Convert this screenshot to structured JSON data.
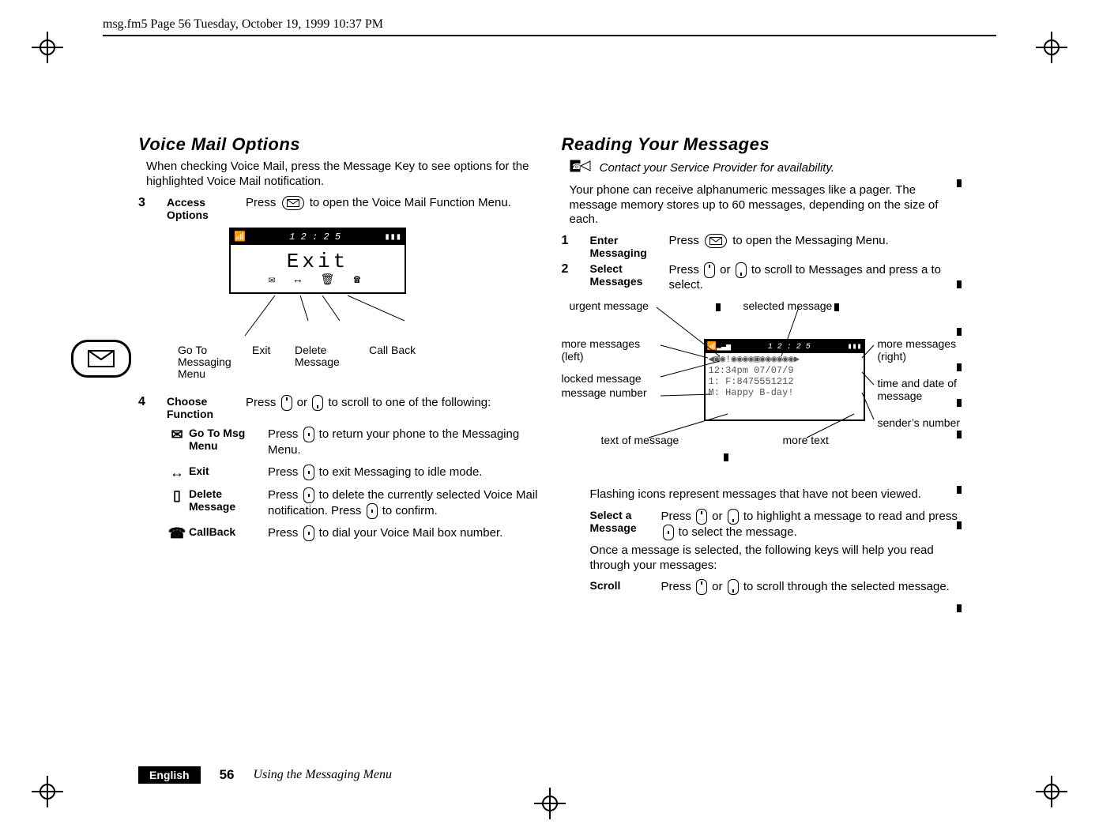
{
  "topline": "msg.fm5  Page 56  Tuesday, October 19, 1999  10:37 PM",
  "left": {
    "title": "Voice Mail Options",
    "intro": "When checking Voice Mail, press the Message Key to see options for the highlighted Voice Mail notification.",
    "step3": {
      "num": "3",
      "label": "Access Options",
      "text_before": "Press ",
      "text_after": " to open the Voice Mail Function Menu."
    },
    "lcd": {
      "time": "1 2 : 2 5",
      "big": "Exit",
      "iconbar": "✉ ↔ 🗑 ☎"
    },
    "callouts": {
      "goto": "Go To Messaging Menu",
      "exit": "Exit",
      "delete": "Delete Message",
      "callback": "Call Back"
    },
    "step4": {
      "num": "4",
      "label": "Choose Function",
      "text_before": "Press ",
      "text_mid": " or ",
      "text_after": " to scroll to one of the following:"
    },
    "options": [
      {
        "icon": "goto-msg-icon",
        "name": "Go To Msg Menu",
        "desc_before": "Press ",
        "desc_after": " to return your phone to the Messaging Menu."
      },
      {
        "icon": "exit-icon",
        "name": "Exit",
        "desc_before": "Press ",
        "desc_after": " to exit Messaging to idle mode."
      },
      {
        "icon": "delete-icon",
        "name": "Delete Message",
        "desc_before": "Press ",
        "desc_mid": " to delete the currently selected Voice Mail notification. Press ",
        "desc_after": " to confirm."
      },
      {
        "icon": "callback-icon",
        "name": "CallBack",
        "desc_before": "Press ",
        "desc_after": " to dial your Voice Mail box number."
      }
    ]
  },
  "right": {
    "title": "Reading Your Messages",
    "note": "Contact your Service Provider for availability.",
    "intro": "Your phone can receive alphanumeric messages like a pager. The message memory stores up to 60 messages, depending on the size of each.",
    "step1": {
      "num": "1",
      "label": "Enter Messaging",
      "text_before": "Press ",
      "text_after": " to open the Messaging Menu."
    },
    "step2": {
      "num": "2",
      "label": "Select Messages",
      "text_before": "Press ",
      "text_mid": " or ",
      "text_mid2": " to scroll to Messages and press a to select."
    },
    "diagram": {
      "labels": {
        "urgent": "urgent message",
        "selected": "selected message",
        "moreLeft": "more messages (left)",
        "locked": "locked message",
        "msgNumber": "message number",
        "textOfMsg": "text of message",
        "moreText": "more text",
        "moreRight": "more messages (right)",
        "timeDate": "time and date of message",
        "sender": "sender’s number"
      },
      "lcd": {
        "band_time": "1 2 : 2 5",
        "row1": "◀▣◉!◉◉◉◉▣◉◉◉◉◉◉▶",
        "row2": "12:34pm 07/07/9",
        "row3": "1: F:8475551212",
        "row4": "M: Happy B-day!"
      }
    },
    "flashing": "Flashing icons represent messages that have not been viewed.",
    "select": {
      "label": "Select a Message",
      "text_before": "Press ",
      "text_mid": " or ",
      "text_mid2": " to highlight a message to read and press ",
      "text_after": " to select the message."
    },
    "once": "Once a message is selected, the following keys will help you read through your messages:",
    "scroll": {
      "label": "Scroll",
      "text_before": "Press ",
      "text_mid": " or ",
      "text_after": " to scroll through the selected message."
    }
  },
  "footer": {
    "lang": "English",
    "page": "56",
    "chapter": "Using the Messaging Menu"
  },
  "colors": {
    "black": "#000000",
    "white": "#ffffff",
    "grey": "#555555"
  }
}
